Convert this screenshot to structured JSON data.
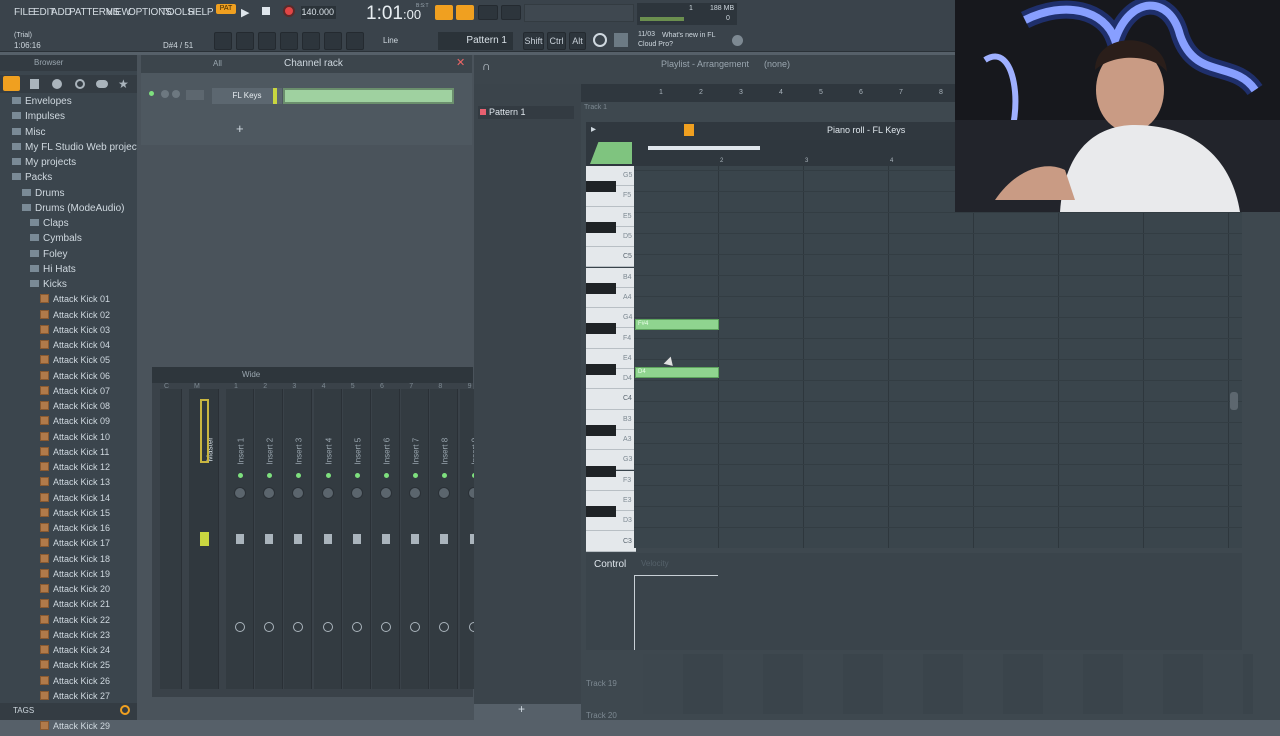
{
  "menu": [
    "FILE",
    "EDIT",
    "ADD",
    "PATTERNS",
    "VIEW",
    "OPTIONS",
    "TOOLS",
    "HELP"
  ],
  "transport": {
    "pat_label": "PAT",
    "song_label": "SONG",
    "tempo": "140.000",
    "time": "1:01",
    "time_sub": ":00",
    "bst": "B:S:T"
  },
  "status": {
    "trial": "(Trial)",
    "position": "1:06:16",
    "note": "D#4 / 51"
  },
  "toolbar": {
    "snap": "Line",
    "pattern": "Pattern 1",
    "shift": "Shift",
    "ctrl": "Ctrl",
    "alt": "Alt",
    "news_date": "11/03",
    "news_text": "What's new in FL Cloud Pro?"
  },
  "cpu": {
    "cpu_value": "1",
    "ram": "188 MB",
    "poly": "0"
  },
  "browser": {
    "title": "Browser",
    "items": [
      {
        "label": "Envelopes",
        "level": 0,
        "type": "folder"
      },
      {
        "label": "Impulses",
        "level": 0,
        "type": "folder"
      },
      {
        "label": "Misc",
        "level": 0,
        "type": "folder"
      },
      {
        "label": "My FL Studio Web projects",
        "level": 0,
        "type": "folder"
      },
      {
        "label": "My projects",
        "level": 0,
        "type": "folder"
      },
      {
        "label": "Packs",
        "level": 0,
        "type": "folder"
      },
      {
        "label": "Drums",
        "level": 1,
        "type": "folder"
      },
      {
        "label": "Drums (ModeAudio)",
        "level": 1,
        "type": "folder"
      },
      {
        "label": "Claps",
        "level": 2,
        "type": "folder"
      },
      {
        "label": "Cymbals",
        "level": 2,
        "type": "folder"
      },
      {
        "label": "Foley",
        "level": 2,
        "type": "folder"
      },
      {
        "label": "Hi Hats",
        "level": 2,
        "type": "folder"
      },
      {
        "label": "Kicks",
        "level": 2,
        "type": "folder"
      },
      {
        "label": "Attack Kick 01",
        "level": 3,
        "type": "file"
      },
      {
        "label": "Attack Kick 02",
        "level": 3,
        "type": "file"
      },
      {
        "label": "Attack Kick 03",
        "level": 3,
        "type": "file"
      },
      {
        "label": "Attack Kick 04",
        "level": 3,
        "type": "file"
      },
      {
        "label": "Attack Kick 05",
        "level": 3,
        "type": "file"
      },
      {
        "label": "Attack Kick 06",
        "level": 3,
        "type": "file"
      },
      {
        "label": "Attack Kick 07",
        "level": 3,
        "type": "file"
      },
      {
        "label": "Attack Kick 08",
        "level": 3,
        "type": "file"
      },
      {
        "label": "Attack Kick 09",
        "level": 3,
        "type": "file"
      },
      {
        "label": "Attack Kick 10",
        "level": 3,
        "type": "file"
      },
      {
        "label": "Attack Kick 11",
        "level": 3,
        "type": "file"
      },
      {
        "label": "Attack Kick 12",
        "level": 3,
        "type": "file"
      },
      {
        "label": "Attack Kick 13",
        "level": 3,
        "type": "file"
      },
      {
        "label": "Attack Kick 14",
        "level": 3,
        "type": "file"
      },
      {
        "label": "Attack Kick 15",
        "level": 3,
        "type": "file"
      },
      {
        "label": "Attack Kick 16",
        "level": 3,
        "type": "file"
      },
      {
        "label": "Attack Kick 17",
        "level": 3,
        "type": "file"
      },
      {
        "label": "Attack Kick 18",
        "level": 3,
        "type": "file"
      },
      {
        "label": "Attack Kick 19",
        "level": 3,
        "type": "file"
      },
      {
        "label": "Attack Kick 20",
        "level": 3,
        "type": "file"
      },
      {
        "label": "Attack Kick 21",
        "level": 3,
        "type": "file"
      },
      {
        "label": "Attack Kick 22",
        "level": 3,
        "type": "file"
      },
      {
        "label": "Attack Kick 23",
        "level": 3,
        "type": "file"
      },
      {
        "label": "Attack Kick 24",
        "level": 3,
        "type": "file"
      },
      {
        "label": "Attack Kick 25",
        "level": 3,
        "type": "file"
      },
      {
        "label": "Attack Kick 26",
        "level": 3,
        "type": "file"
      },
      {
        "label": "Attack Kick 27",
        "level": 3,
        "type": "file"
      },
      {
        "label": "Attack Kick 28",
        "level": 3,
        "type": "file"
      },
      {
        "label": "Attack Kick 29",
        "level": 3,
        "type": "file"
      }
    ],
    "tags_label": "TAGS"
  },
  "channel_rack": {
    "title": "Channel rack",
    "filter": "All",
    "channel": "FL Keys"
  },
  "mixer": {
    "view": "Wide",
    "master": "Master",
    "inserts": [
      "Insert 1",
      "Insert 2",
      "Insert 3",
      "Insert 4",
      "Insert 5",
      "Insert 6",
      "Insert 7",
      "Insert 8",
      "Insert 9"
    ],
    "numbers": [
      "C",
      "M",
      "1",
      "2",
      "3",
      "4",
      "5",
      "6",
      "7",
      "8",
      "9"
    ]
  },
  "pattern_list": {
    "item": "Pattern 1"
  },
  "playlist": {
    "title": "Playlist - Arrangement",
    "arrangement": "(none)",
    "track_top": "Track 1",
    "track_19": "Track 19",
    "track_20": "Track 20",
    "bars": [
      "1",
      "2",
      "3",
      "4",
      "5",
      "6",
      "7",
      "8"
    ]
  },
  "piano_roll": {
    "title": "Piano roll - FL Keys",
    "keys": [
      "G5",
      "F5",
      "E5",
      "D5",
      "C5",
      "B4",
      "A4",
      "G4",
      "F4",
      "E4",
      "D4",
      "C4",
      "B3",
      "A3",
      "G3",
      "F3",
      "E3",
      "D3",
      "C3"
    ],
    "bars": [
      "2",
      "3",
      "4"
    ],
    "notes": [
      {
        "label": "F#4"
      },
      {
        "label": "D4"
      }
    ],
    "control_label": "Control",
    "control_param": "Velocity"
  },
  "colors": {
    "note": "#8fd48f",
    "accent": "#f0a020",
    "led": "#7ee07e",
    "grid": "#3a454c"
  }
}
